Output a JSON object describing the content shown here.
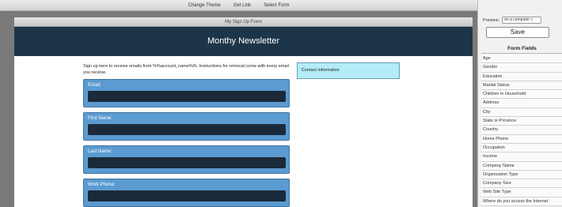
{
  "toolbar": {
    "change_theme": "Change Theme",
    "get_link": "Get Link",
    "select_form": "Select Form"
  },
  "form": {
    "window_title": "My Sign Up Form",
    "banner_title": "Monthy Newsletter",
    "intro_text": "Sign up here to receive emails from %%account_name%%. Instructions for removal come with every email you receive.",
    "contact_info_label": "Contact information",
    "fields": [
      "Email:",
      "First Name:",
      "Last Name:",
      "Work Phone:"
    ]
  },
  "panel": {
    "preview_label": "Preview:",
    "preview_value": "on a computer ◊",
    "save_label": "Save",
    "form_fields_header": "Form Fields",
    "form_fields": [
      "Age",
      "Gender",
      "Education",
      "Marital Status",
      "Children in Household",
      "Address",
      "City",
      "State or Province",
      "Country",
      "Home Phone",
      "Occupation",
      "Income",
      "Company Name",
      "Organization Type",
      "Company Size",
      "Web Site Type",
      "Where do you access the Internet"
    ]
  },
  "colors": {
    "banner": "#1d3548",
    "field_block": "#5b9bd1",
    "field_input": "#1b2a3a",
    "contact_box": "#b3ecf7",
    "workspace": "#7a7a7a"
  }
}
